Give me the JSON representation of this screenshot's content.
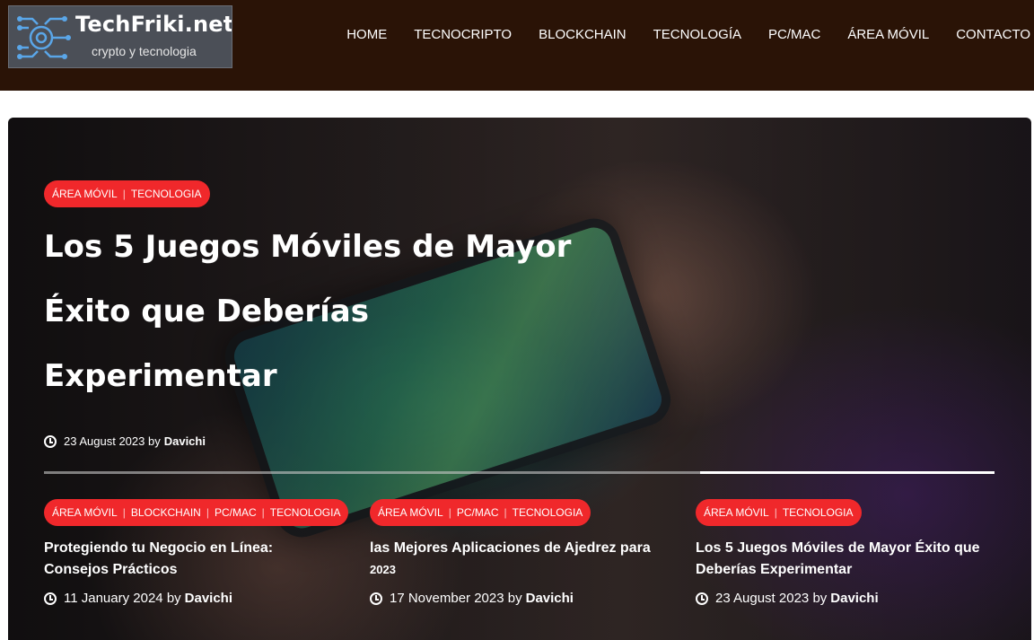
{
  "site": {
    "title": "TechFriki.net",
    "tagline": "crypto y tecnologia"
  },
  "nav": [
    "HOME",
    "TECNOCRIPTO",
    "BLOCKCHAIN",
    "TECNOLOGÍA",
    "PC/MAC",
    "ÁREA MÓVIL",
    "CONTACTO"
  ],
  "hero": {
    "categories": [
      "ÁREA MÓVIL",
      "TECNOLOGIA"
    ],
    "title_line1": "Los 5 Juegos Móviles de Mayor",
    "title_line2": "Éxito que Deberías",
    "title_line3": "Experimentar",
    "date": "23 August 2023",
    "by": "by",
    "author": "Davichi"
  },
  "slider_progress": 0.31,
  "cards": [
    {
      "categories": [
        "ÁREA MÓVIL",
        "BLOCKCHAIN",
        "PC/MAC",
        "TECNOLOGIA"
      ],
      "title_line1": "Protegiendo tu Negocio en Línea:",
      "title_line2": "Consejos Prácticos",
      "date": "11 January 2024",
      "by": "by",
      "author": "Davichi"
    },
    {
      "categories": [
        "ÁREA MÓVIL",
        "PC/MAC",
        "TECNOLOGIA"
      ],
      "title_line1": "las Mejores Aplicaciones de Ajedrez para",
      "title_line2": "2023",
      "date": "17 November 2023",
      "by": "by",
      "author": "Davichi"
    },
    {
      "categories": [
        "ÁREA MÓVIL",
        "TECNOLOGIA"
      ],
      "title_line1": "Los 5 Juegos Móviles de Mayor Éxito que",
      "title_line2": "Deberías Experimentar",
      "date": "23 August 2023",
      "by": "by",
      "author": "Davichi"
    }
  ]
}
